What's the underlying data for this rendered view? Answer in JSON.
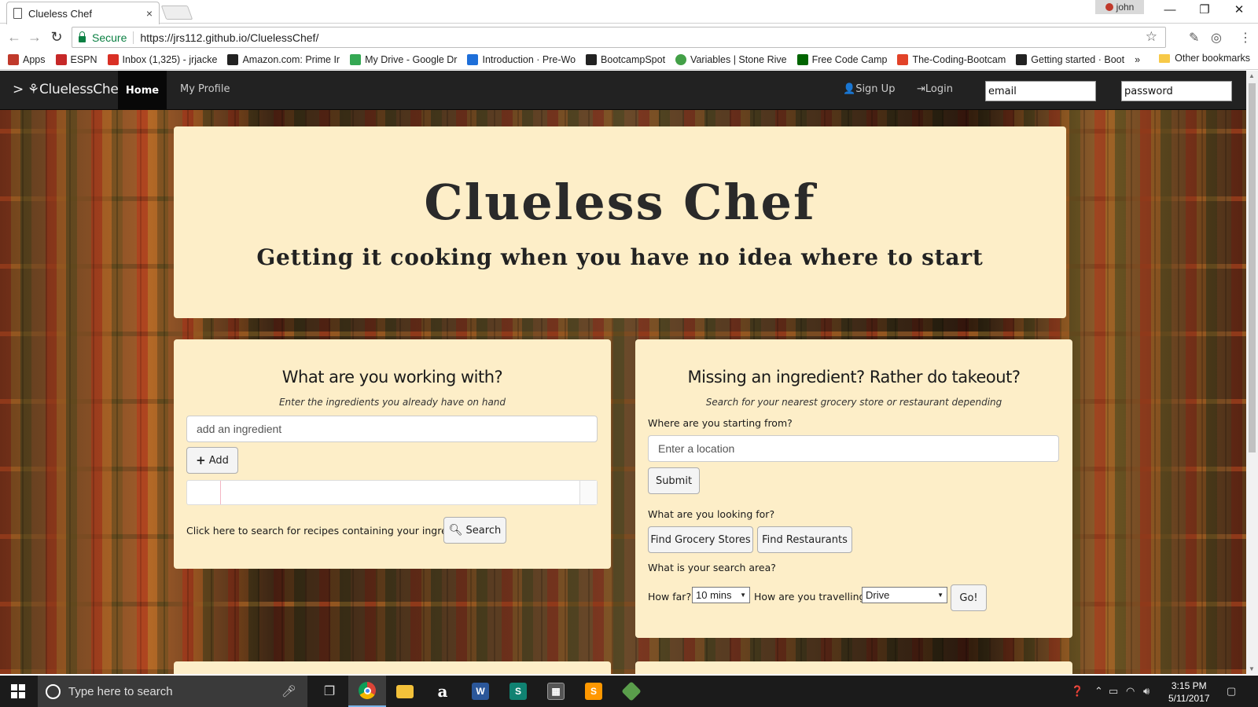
{
  "browser": {
    "tab_title": "Clueless Chef",
    "tab_close": "×",
    "profile_name": "john",
    "window_controls": [
      "—",
      "❐",
      "✕"
    ],
    "secure_label": "Secure",
    "url": "https://jrs112.github.io/CluelessChef/",
    "bookmarks": [
      {
        "label": "Apps",
        "icon": "apps-grid-icon",
        "color": "#c0392b"
      },
      {
        "label": "ESPN",
        "icon": "espn-icon",
        "color": "#c62828"
      },
      {
        "label": "Inbox (1,325) - jrjacke",
        "icon": "gmail-icon",
        "color": "#d93025"
      },
      {
        "label": "Amazon.com: Prime Ir",
        "icon": "amazon-icon",
        "color": "#222222"
      },
      {
        "label": "My Drive - Google Dr",
        "icon": "drive-icon",
        "color": "#34a853"
      },
      {
        "label": "Introduction · Pre-Wo",
        "icon": "bookmark-icon",
        "color": "#1e6fd9"
      },
      {
        "label": "BootcampSpot",
        "icon": "bootcampspot-icon",
        "color": "#222222"
      },
      {
        "label": "Variables | Stone Rive",
        "icon": "stone-river-icon",
        "color": "#43a047"
      },
      {
        "label": "Free Code Camp",
        "icon": "freecodecamp-icon",
        "color": "#006400"
      },
      {
        "label": "The-Coding-Bootcam",
        "icon": "gitlab-icon",
        "color": "#e24329"
      },
      {
        "label": "Getting started · Boot",
        "icon": "bootstrap-icon",
        "color": "#222222"
      }
    ],
    "bookmarks_overflow": "»",
    "other_bookmarks": "Other bookmarks"
  },
  "nav": {
    "brand": "> ⚘CluelessChef",
    "home": "Home",
    "profile": "My Profile",
    "signup": "Sign Up",
    "login": "Login",
    "email_placeholder": "email",
    "password_placeholder": "password"
  },
  "hero": {
    "title": "Clueless Chef",
    "subtitle": "Getting it cooking when you have no idea where to start"
  },
  "ingredients_panel": {
    "heading": "What are you working with?",
    "subtitle": "Enter the ingredients you already have on hand",
    "input_placeholder": "add an ingredient",
    "add_label": "Add",
    "search_prompt": "Click here to search for recipes containing your ingredients:",
    "search_label": "Search"
  },
  "takeout_panel": {
    "heading": "Missing an ingredient? Rather do takeout?",
    "subtitle": "Search for your nearest grocery store or restaurant depending",
    "start_label": "Where are you starting from?",
    "location_placeholder": "Enter a location",
    "submit_label": "Submit",
    "looking_label": "What are you looking for?",
    "grocery_label": "Find Grocery Stores",
    "restaurants_label": "Find Restaurants",
    "area_label": "What is your search area?",
    "how_far_label": "How far?",
    "how_far_value": "10 mins",
    "travel_label": "How are you travelling?",
    "travel_value": "Drive",
    "go_label": "Go!"
  },
  "taskbar": {
    "search_placeholder": "Type here to search",
    "time": "3:15 PM",
    "date": "5/11/2017",
    "apps": [
      "chrome-icon",
      "file-explorer-icon",
      "amazon-icon",
      "word-icon",
      "sway-icon",
      "calculator-icon",
      "sublime-text-icon",
      "git-icon"
    ]
  }
}
